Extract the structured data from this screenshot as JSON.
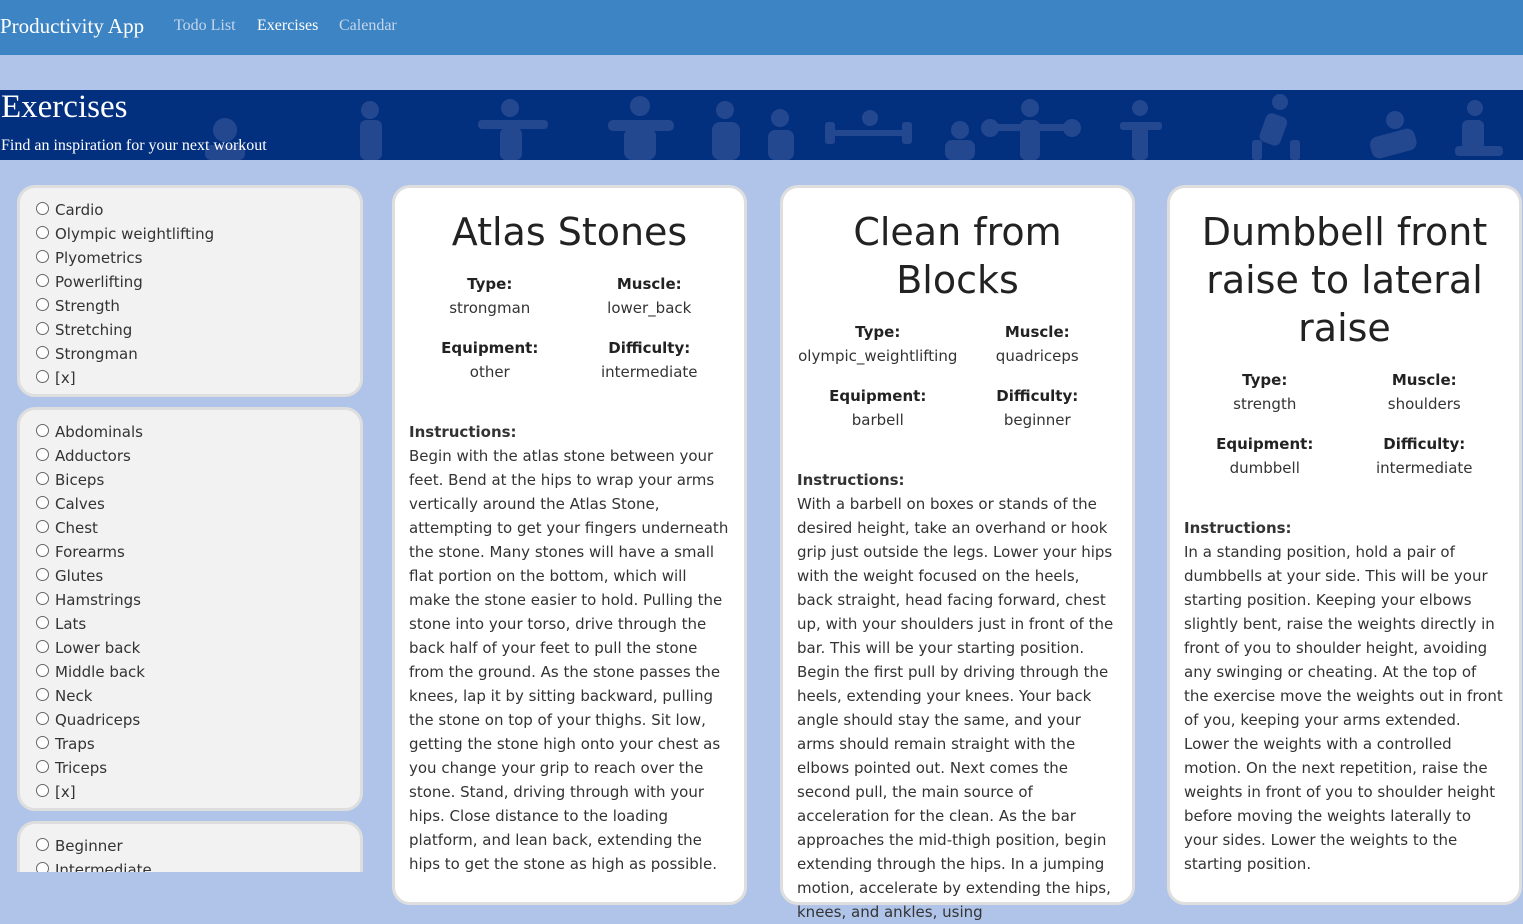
{
  "nav": {
    "brand": "Productivity App",
    "links": [
      {
        "label": "Todo List",
        "active": false
      },
      {
        "label": "Exercises",
        "active": true
      },
      {
        "label": "Calendar",
        "active": false
      }
    ]
  },
  "hero": {
    "title": "Exercises",
    "subtitle": "Find an inspiration for your next workout"
  },
  "filters": {
    "types": [
      "Cardio",
      "Olympic weightlifting",
      "Plyometrics",
      "Powerlifting",
      "Strength",
      "Stretching",
      "Strongman",
      "[x]"
    ],
    "muscles": [
      "Abdominals",
      "Adductors",
      "Biceps",
      "Calves",
      "Chest",
      "Forearms",
      "Glutes",
      "Hamstrings",
      "Lats",
      "Lower back",
      "Middle back",
      "Neck",
      "Quadriceps",
      "Traps",
      "Triceps",
      "[x]"
    ],
    "difficulties": [
      "Beginner",
      "Intermediate"
    ]
  },
  "labels": {
    "type": "Type:",
    "muscle": "Muscle:",
    "equipment": "Equipment:",
    "difficulty": "Difficulty:",
    "instructions": "Instructions:"
  },
  "cards": [
    {
      "title": "Atlas Stones",
      "type": "strongman",
      "muscle": "lower_back",
      "equipment": "other",
      "difficulty": "intermediate",
      "instructions": "Begin with the atlas stone between your feet. Bend at the hips to wrap your arms vertically around the Atlas Stone, attempting to get your fingers underneath the stone. Many stones will have a small flat portion on the bottom, which will make the stone easier to hold. Pulling the stone into your torso, drive through the back half of your feet to pull the stone from the ground. As the stone passes the knees, lap it by sitting backward, pulling the stone on top of your thighs. Sit low, getting the stone high onto your chest as you change your grip to reach over the stone. Stand, driving through with your hips. Close distance to the loading platform, and lean back, extending the hips to get the stone as high as possible."
    },
    {
      "title": "Clean from Blocks",
      "type": "olympic_weightlifting",
      "muscle": "quadriceps",
      "equipment": "barbell",
      "difficulty": "beginner",
      "instructions": "With a barbell on boxes or stands of the desired height, take an overhand or hook grip just outside the legs. Lower your hips with the weight focused on the heels, back straight, head facing forward, chest up, with your shoulders just in front of the bar. This will be your starting position. Begin the first pull by driving through the heels, extending your knees. Your back angle should stay the same, and your arms should remain straight with the elbows pointed out. Next comes the second pull, the main source of acceleration for the clean. As the bar approaches the mid-thigh position, begin extending through the hips. In a jumping motion, accelerate by extending the hips, knees, and ankles, using"
    },
    {
      "title": "Dumbbell front raise to lateral raise",
      "type": "strength",
      "muscle": "shoulders",
      "equipment": "dumbbell",
      "difficulty": "intermediate",
      "instructions": "In a standing position, hold a pair of dumbbells at your side. This will be your starting position. Keeping your elbows slightly bent, raise the weights directly in front of you to shoulder height, avoiding any swinging or cheating. At the top of the exercise move the weights out in front of you, keeping your arms extended. Lower the weights with a controlled motion. On the next repetition, raise the weights in front of you to shoulder height before moving the weights laterally to your sides. Lower the weights to the starting position."
    }
  ]
}
